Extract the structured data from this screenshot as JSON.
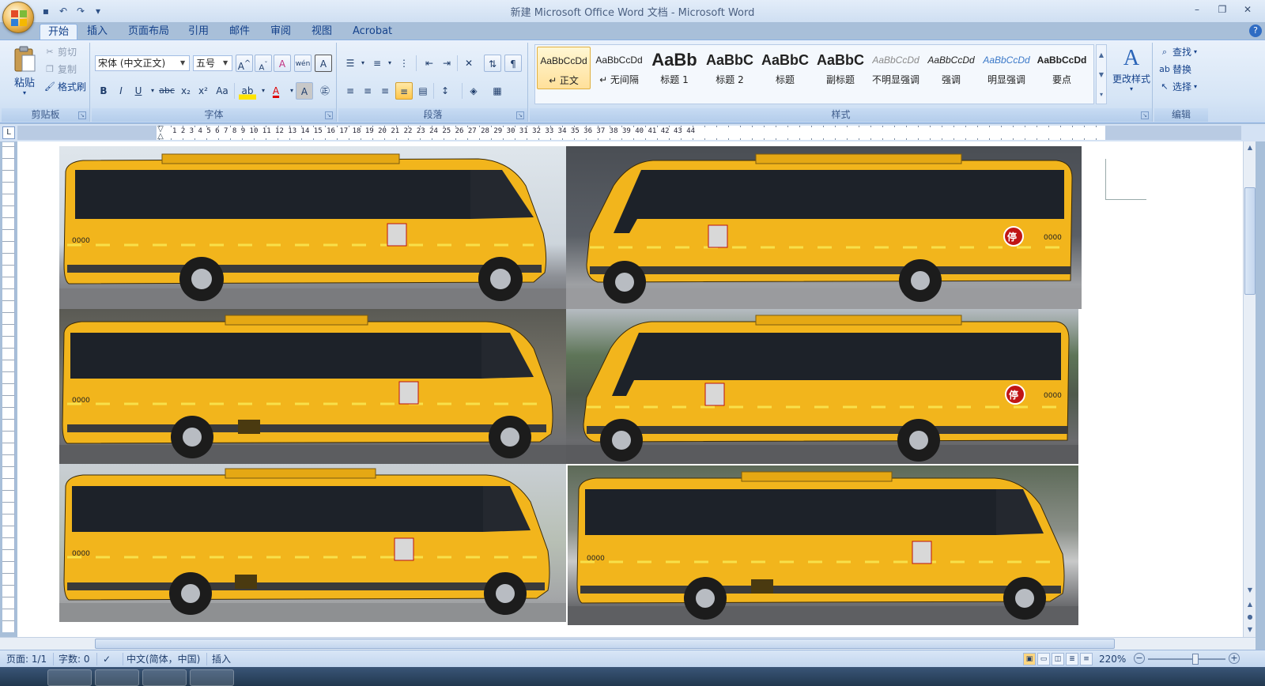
{
  "window": {
    "title": "新建 Microsoft Office Word 文档 - Microsoft Word"
  },
  "qat": {
    "save_icon": "save-icon",
    "undo_icon": "undo-icon",
    "redo_icon": "redo-icon",
    "customize_icon": "customize-qat-icon"
  },
  "tabs": [
    "开始",
    "插入",
    "页面布局",
    "引用",
    "邮件",
    "审阅",
    "视图",
    "Acrobat"
  ],
  "clipboard": {
    "paste": "粘贴",
    "cut": "剪切",
    "copy": "复制",
    "format_painter": "格式刷",
    "label": "剪贴板"
  },
  "font": {
    "name": "宋体 (中文正文)",
    "size": "五号",
    "label": "字体",
    "bold": "B",
    "italic": "I",
    "underline": "U",
    "strike": "abc",
    "subscript": "x₂",
    "superscript": "x²",
    "change_case": "Aa",
    "grow": "A",
    "shrink": "A",
    "clear": "A",
    "highlight": "ab",
    "font_color": "A",
    "char_shading": "A",
    "phonetic": "wén"
  },
  "paragraph": {
    "label": "段落"
  },
  "styles": {
    "label": "样式",
    "change_styles": "更改样式",
    "items": [
      {
        "sample": "AaBbCcDd",
        "name": "↵ 正文"
      },
      {
        "sample": "AaBbCcDd",
        "name": "↵ 无间隔"
      },
      {
        "sample": "AaBb",
        "name": "标题 1"
      },
      {
        "sample": "AaBbC",
        "name": "标题 2"
      },
      {
        "sample": "AaBbC",
        "name": "标题"
      },
      {
        "sample": "AaBbC",
        "name": "副标题"
      },
      {
        "sample": "AaBbCcDd",
        "name": "不明显强调"
      },
      {
        "sample": "AaBbCcDd",
        "name": "强调"
      },
      {
        "sample": "AaBbCcDd",
        "name": "明显强调"
      },
      {
        "sample": "AaBbCcDd",
        "name": "要点"
      }
    ]
  },
  "editing": {
    "label": "编辑",
    "find": "查找",
    "replace": "替换",
    "select": "选择"
  },
  "ruler": {
    "corner": "L",
    "numbers": "1 2 3 4 5 6 7 8 9 10 11 12 13 14 15 16 17 18 19 20 21 22 23 24 25 26 27 28 29 30 31 32 33 34 35 36 37 38 39 40 41 42 43 44"
  },
  "document": {
    "photos": [
      {
        "label": "0000",
        "side": "left-facing"
      },
      {
        "label": "0000",
        "side": "right-facing"
      },
      {
        "label": "0000",
        "side": "left-facing"
      },
      {
        "label": "0000",
        "side": "right-facing"
      },
      {
        "label": "0000",
        "side": "left-facing"
      },
      {
        "label": "0000",
        "side": "left-facing"
      }
    ],
    "stop_sign": "停"
  },
  "status": {
    "page": "页面: 1/1",
    "words": "字数: 0",
    "language": "中文(简体，中国)",
    "mode": "插入",
    "zoom": "220%"
  },
  "colors": {
    "bus_yellow": "#f2b51c",
    "ribbon_blue": "#d6e5f6",
    "accent": "#15428b"
  }
}
